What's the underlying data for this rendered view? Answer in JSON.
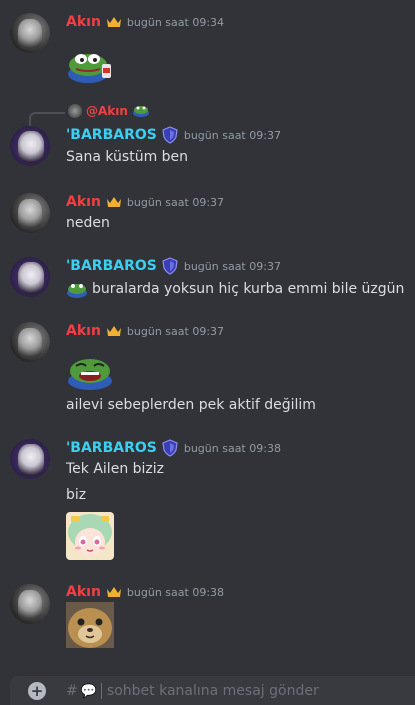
{
  "messages": [
    {
      "author": "Akın",
      "time": "bugün saat 09:34"
    },
    {
      "author": "'BARBAROS",
      "time": "bugün saat 09:37",
      "reply_to": "@Akın",
      "text": "Sana küstüm ben"
    },
    {
      "author": "Akın",
      "time": "bugün saat 09:37",
      "text": "neden"
    },
    {
      "author": "'BARBAROS",
      "time": "bugün saat 09:37",
      "text": "buralarda yoksun hiç kurba emmi bile üzgün"
    },
    {
      "author": "Akın",
      "time": "bugün saat 09:37",
      "text": "ailevi sebeplerden pek aktif değilim"
    },
    {
      "author": "'BARBAROS",
      "time": "bugün saat 09:38",
      "text": "Tek Ailen biziz",
      "text2": "biz"
    },
    {
      "author": "Akın",
      "time": "bugün saat 09:38"
    }
  ],
  "composer": {
    "prefix": "#",
    "placeholder": "sohbet kanalına mesaj gönder"
  },
  "colors": {
    "akin": "#f23f43",
    "barbaros": "#3ad0f2",
    "background": "#313338"
  }
}
